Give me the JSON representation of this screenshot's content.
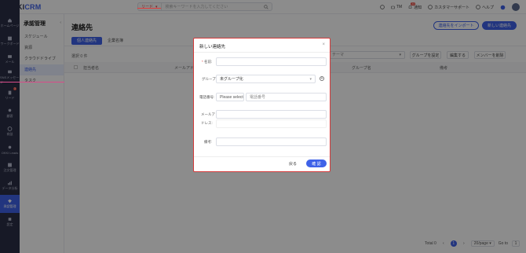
{
  "app": {
    "logo_main": "OKKI",
    "logo_suffix": "CRM"
  },
  "header": {
    "search_type": "リード",
    "search_placeholder": "検索キーワードを入力してください",
    "items": [
      "TM",
      "通知",
      "カスタマーサポート",
      "ヘルプ"
    ],
    "notify_badge": "33"
  },
  "rail": {
    "items": [
      {
        "label": "ホームページ",
        "icon": "home-icon"
      },
      {
        "label": "ワークボード",
        "icon": "board-icon"
      },
      {
        "label": "メール",
        "icon": "mail-icon"
      },
      {
        "label": "SNSメッセージ",
        "icon": "chat-icon"
      },
      {
        "label": "リード",
        "icon": "lead-icon",
        "badge": "3"
      },
      {
        "label": "顧客",
        "icon": "customer-icon"
      },
      {
        "label": "商談",
        "icon": "deal-icon"
      },
      {
        "label": "OKKI Leads",
        "icon": "leads-icon"
      },
      {
        "label": "注文管理",
        "icon": "order-icon"
      },
      {
        "label": "データ分析",
        "icon": "chart-icon"
      },
      {
        "label": "承認管理",
        "icon": "approval-icon",
        "active": true
      },
      {
        "label": "設定",
        "icon": "settings-icon"
      }
    ]
  },
  "sub_sidebar": {
    "title": "承認管理",
    "items": [
      "スケジュール",
      "資源",
      "クラウドドライブ",
      "連絡先",
      "タスク"
    ],
    "active_index": 3
  },
  "main": {
    "title": "連絡先",
    "import_button": "連絡先をインポート",
    "new_button": "新しい連絡先",
    "tabs": [
      "個人連絡先",
      "企業名簿"
    ],
    "active_tab": 0,
    "selected_count": "選択 0 件",
    "theme_placeholder": "テーマ",
    "group_settings": "グループを設定",
    "edit_button": "編集する",
    "delete_member": "メンバーを削除",
    "columns": [
      "担当者名",
      "メールアドレス",
      "グループ名",
      "備考"
    ]
  },
  "pager": {
    "total": "Total 0",
    "page": "1",
    "size": "20/page",
    "goto": "Go to",
    "goto_value": "1"
  },
  "modal": {
    "title": "新しい連絡先",
    "name_label": "名前:",
    "group_label": "グループ:",
    "group_value": "未グループ化",
    "phone_label": "電話番号:",
    "phone_code_placeholder": "Please select",
    "phone_placeholder": "電話番号",
    "email_label_1": "メールア",
    "email_label_2": "ドレス:",
    "memo_label": "備考:",
    "back_button": "戻る",
    "ok_button": "確 認"
  },
  "colors": {
    "accent": "#3f62e8",
    "rail": "#2b2f45",
    "danger": "#e23c3c"
  }
}
